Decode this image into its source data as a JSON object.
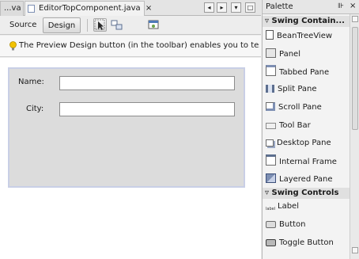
{
  "editor": {
    "tabs": [
      {
        "label": "...va",
        "active": false
      },
      {
        "label": "EditorTopComponent.java",
        "active": true
      }
    ],
    "tab_close": "×",
    "nav_buttons": [
      "◂",
      "▸",
      "▾",
      "□"
    ]
  },
  "toolbar": {
    "source_label": "Source",
    "design_label": "Design"
  },
  "hint": {
    "text": "The Preview Design button (in the toolbar) enables you to test th"
  },
  "form": {
    "fields": [
      {
        "label": "Name:",
        "value": ""
      },
      {
        "label": "City:",
        "value": ""
      }
    ]
  },
  "palette": {
    "title": "Palette",
    "header_icons": [
      "⊪",
      "×"
    ],
    "categories": [
      {
        "label": "Swing Contain...",
        "items": [
          {
            "label": "BeanTreeView",
            "icon": "bean-tree-view-icon"
          },
          {
            "label": "Panel",
            "icon": "panel-icon"
          },
          {
            "label": "Tabbed Pane",
            "icon": "tabbed-pane-icon"
          },
          {
            "label": "Split Pane",
            "icon": "split-pane-icon"
          },
          {
            "label": "Scroll Pane",
            "icon": "scroll-pane-icon"
          },
          {
            "label": "Tool Bar",
            "icon": "tool-bar-icon"
          },
          {
            "label": "Desktop Pane",
            "icon": "desktop-pane-icon"
          },
          {
            "label": "Internal Frame",
            "icon": "internal-frame-icon"
          },
          {
            "label": "Layered Pane",
            "icon": "layered-pane-icon"
          }
        ]
      },
      {
        "label": "Swing Controls",
        "items": [
          {
            "label": "Label",
            "icon": "label-icon"
          },
          {
            "label": "Button",
            "icon": "button-icon"
          },
          {
            "label": "Toggle Button",
            "icon": "toggle-button-icon"
          }
        ]
      }
    ]
  },
  "colors": {
    "form_background": "#dcdcdc",
    "selection_border": "#c9cfe6",
    "hint_bulb": "#f2c200"
  }
}
